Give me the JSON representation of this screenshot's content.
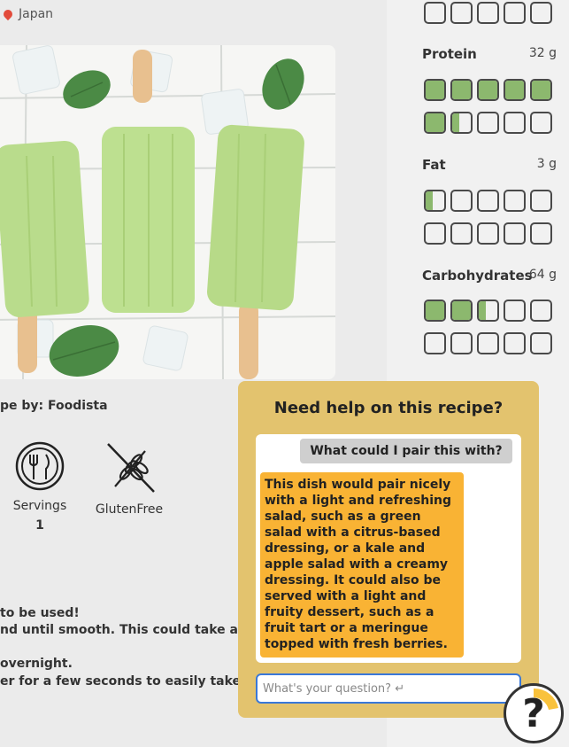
{
  "location": {
    "icon": "map-pin-icon",
    "label": "Japan"
  },
  "recipe": {
    "image_alt": "Green popsicles with mint leaves",
    "byline": "pe by: Foodista",
    "attributes": [
      {
        "icon": "utensils-icon",
        "label": "Servings",
        "value": "1"
      },
      {
        "icon": "wheat-crossed-icon",
        "label": "GlutenFree"
      }
    ],
    "instructions": [
      "to be used!",
      "nd until smooth. This could take a few m",
      " overnight.",
      "er for a few seconds to easily take the p"
    ]
  },
  "nutrition": [
    {
      "name": "Protein",
      "value": "32 g",
      "fills": [
        1,
        1,
        1,
        1,
        1,
        1,
        0.4,
        0,
        0,
        0
      ]
    },
    {
      "name": "Fat",
      "value": "3 g",
      "fills": [
        0.4,
        0,
        0,
        0,
        0,
        0,
        0,
        0,
        0,
        0
      ]
    },
    {
      "name": "Carbohydrates",
      "value": "64 g",
      "fills": [
        1,
        1,
        0.4,
        0,
        0,
        0,
        0,
        0,
        0,
        0
      ]
    }
  ],
  "chat": {
    "title": "Need help on this recipe?",
    "question": "What could I pair this with?",
    "answer": "This dish would pair nicely with a light and refreshing salad, such as a green salad with a citrus-based dressing, or a kale and apple salad with a creamy dressing. It could also be served with a light and fruity dessert, such as a fruit tart or a meringue topped with fresh berries.",
    "input_placeholder": "What's your question? ↵"
  },
  "help_button": {
    "label": "?",
    "icon": "help-icon"
  },
  "colors": {
    "nutrition_fill": "#8cb86e",
    "chat_panel": "#e3c36e",
    "answer_bubble": "#f9b334",
    "question_bubble": "#cfcfcf",
    "input_border": "#3a78d8"
  }
}
